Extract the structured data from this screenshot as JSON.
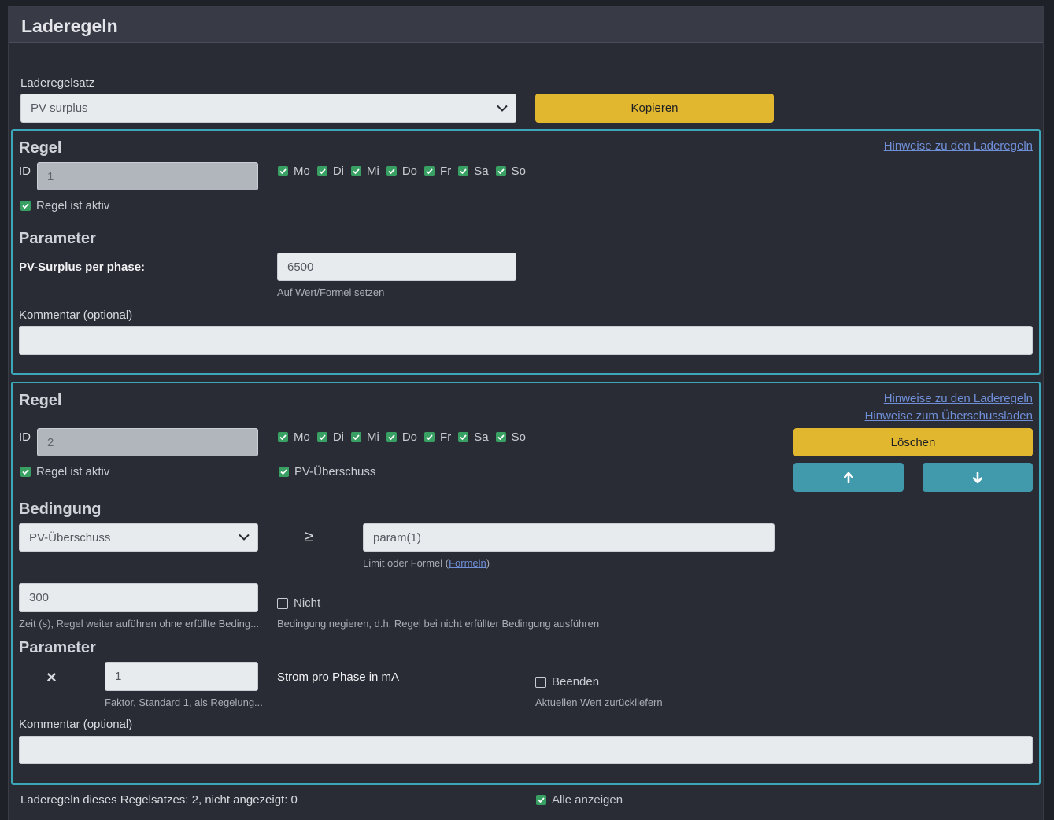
{
  "header": {
    "title": "Laderegeln"
  },
  "ruleset": {
    "label": "Laderegelsatz",
    "selected": "PV surplus",
    "copy_button": "Kopieren"
  },
  "rule1": {
    "title": "Regel",
    "hint_link": "Hinweise zu den Laderegeln",
    "id_label": "ID",
    "id_value": "1",
    "days": [
      "Mo",
      "Di",
      "Mi",
      "Do",
      "Fr",
      "Sa",
      "So"
    ],
    "active_label": "Regel ist aktiv",
    "param_title": "Parameter",
    "param_label": "PV-Surplus per phase:",
    "param_value": "6500",
    "param_help": "Auf Wert/Formel setzen",
    "comment_label": "Kommentar (optional)",
    "comment_value": ""
  },
  "rule2": {
    "title": "Regel",
    "hint_link": "Hinweise zu den Laderegeln",
    "hint_link2": "Hinweise zum Überschussladen",
    "id_label": "ID",
    "id_value": "2",
    "days": [
      "Mo",
      "Di",
      "Mi",
      "Do",
      "Fr",
      "Sa",
      "So"
    ],
    "active_label": "Regel ist aktiv",
    "surplus_label": "PV-Überschuss",
    "delete_button": "Löschen",
    "condition_title": "Bedingung",
    "condition_selected": "PV-Überschuss",
    "operator": "≥",
    "limit_value": "param(1)",
    "limit_help_prefix": "Limit oder Formel (",
    "limit_help_link": "Formeln",
    "limit_help_suffix": ")",
    "time_value": "300",
    "time_help": "Zeit (s), Regel weiter auführen ohne erfüllte Beding...",
    "not_label": "Nicht",
    "not_help": "Bedingung negieren, d.h. Regel bei nicht erfüllter Bedingung ausführen",
    "param_title": "Parameter",
    "multiply_symbol": "×",
    "factor_value": "1",
    "factor_help": "Faktor, Standard 1, als Regelung...",
    "current_label": "Strom pro Phase in mA",
    "end_label": "Beenden",
    "end_help": "Aktuellen Wert zurückliefern",
    "comment_label": "Kommentar (optional)",
    "comment_value": ""
  },
  "footer": {
    "summary": "Laderegeln dieses Regelsatzes: 2, nicht angezeigt: 0",
    "show_all_label": "Alle anzeigen"
  },
  "colors": {
    "accent_yellow": "#e1b72f",
    "accent_teal": "#4199ac",
    "card_border": "#3ba7b8",
    "checkbox_green": "#39a064"
  }
}
